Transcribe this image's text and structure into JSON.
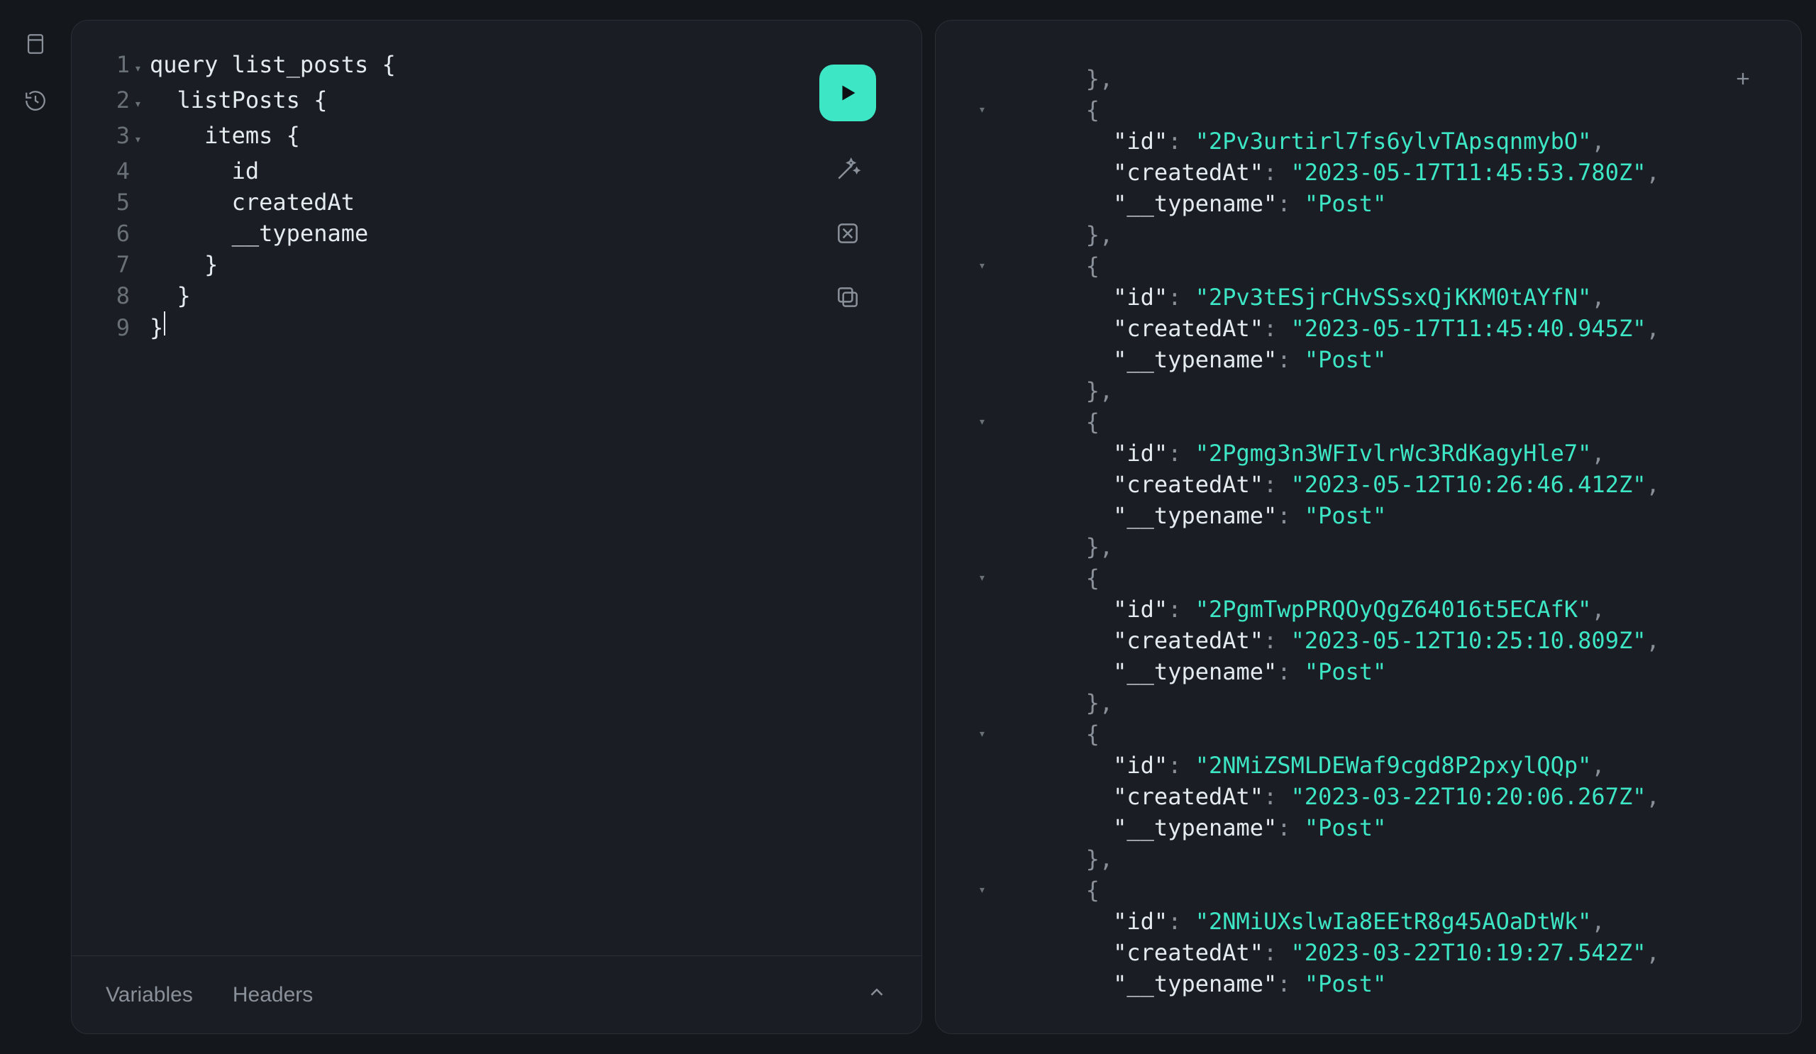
{
  "rail": {
    "docs_icon": "docs-icon",
    "history_icon": "history-icon"
  },
  "editor": {
    "lines": [
      {
        "n": "1",
        "fold": "▾",
        "text": "query list_posts {"
      },
      {
        "n": "2",
        "fold": "▾",
        "text": "  listPosts {"
      },
      {
        "n": "3",
        "fold": "▾",
        "text": "    items {"
      },
      {
        "n": "4",
        "fold": "",
        "text": "      id"
      },
      {
        "n": "5",
        "fold": "",
        "text": "      createdAt"
      },
      {
        "n": "6",
        "fold": "",
        "text": "      __typename"
      },
      {
        "n": "7",
        "fold": "",
        "text": "    }"
      },
      {
        "n": "8",
        "fold": "",
        "text": "  }"
      },
      {
        "n": "9",
        "fold": "",
        "text": "}",
        "cursor": true
      }
    ],
    "actions": {
      "run": "run",
      "prettify": "prettify",
      "merge": "merge",
      "copy": "copy"
    }
  },
  "bottom": {
    "variables": "Variables",
    "headers": "Headers"
  },
  "result": {
    "items": [
      {
        "id": "2Pv3urtirl7fs6ylvTApsqnmybO",
        "createdAt": "2023-05-17T11:45:53.780Z",
        "__typename": "Post"
      },
      {
        "id": "2Pv3tESjrCHvSSsxQjKKM0tAYfN",
        "createdAt": "2023-05-17T11:45:40.945Z",
        "__typename": "Post"
      },
      {
        "id": "2Pgmg3n3WFIvlrWc3RdKagyHle7",
        "createdAt": "2023-05-12T10:26:46.412Z",
        "__typename": "Post"
      },
      {
        "id": "2PgmTwpPRQOyQgZ64016t5ECAfK",
        "createdAt": "2023-05-12T10:25:10.809Z",
        "__typename": "Post"
      },
      {
        "id": "2NMiZSMLDEWaf9cgd8P2pxylQQp",
        "createdAt": "2023-03-22T10:20:06.267Z",
        "__typename": "Post"
      },
      {
        "id": "2NMiUXslwIa8EEtR8g45AOaDtWk",
        "createdAt": "2023-03-22T10:19:27.542Z",
        "__typename": "Post"
      }
    ],
    "leading_close": true
  }
}
